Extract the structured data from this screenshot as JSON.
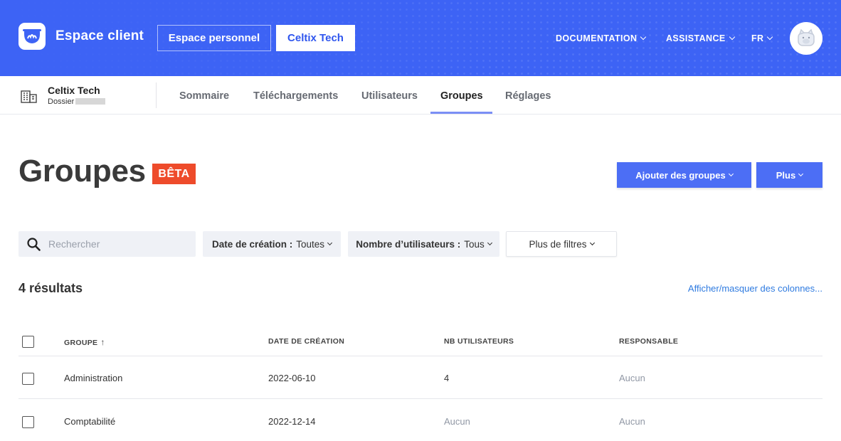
{
  "header": {
    "app_title": "Espace client",
    "btn_personal": "Espace personnel",
    "btn_company": "Celtix Tech",
    "menu_documentation": "DOCUMENTATION",
    "menu_assistance": "ASSISTANCE",
    "menu_lang": "FR",
    "brand_color": "#3d63f5"
  },
  "org": {
    "name": "Celtix Tech",
    "sub_label": "Dossier"
  },
  "tabs": [
    {
      "label": "Sommaire"
    },
    {
      "label": "Téléchargements"
    },
    {
      "label": "Utilisateurs"
    },
    {
      "label": "Groupes",
      "active": true
    },
    {
      "label": "Réglages"
    }
  ],
  "page": {
    "title": "Groupes",
    "badge": "BÊTA",
    "add_button": "Ajouter des groupes",
    "more_button": "Plus",
    "badge_color": "#ee4b2b",
    "primary_color": "#4c6ef5"
  },
  "filters": {
    "search_placeholder": "Rechercher",
    "creation_date_label": "Date de création :",
    "creation_date_value": "Toutes",
    "users_count_label": "Nombre d’utilisateurs :",
    "users_count_value": "Tous",
    "more_filters": "Plus de filtres"
  },
  "results": {
    "count_text": "4 résultats",
    "toggle_columns": "Afficher/masquer des colonnes..."
  },
  "table": {
    "columns": [
      "GROUPE",
      "DATE DE CRÉATION",
      "NB UTILISATEURS",
      "RESPONSABLE"
    ],
    "sort_indicator": "↑",
    "rows": [
      {
        "group": "Administration",
        "created": "2022-06-10",
        "users": "4",
        "owner": "Aucun"
      },
      {
        "group": "Comptabilité",
        "created": "2022-12-14",
        "users": "Aucun",
        "owner": "Aucun"
      }
    ]
  }
}
